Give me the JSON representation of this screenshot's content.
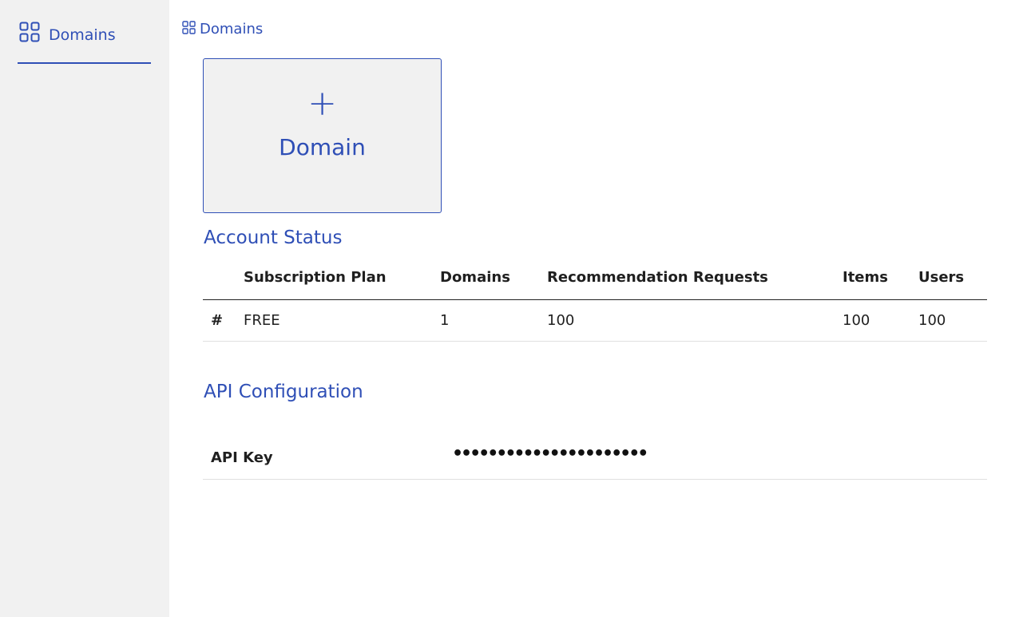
{
  "sidebar": {
    "items": [
      {
        "label": "Domains",
        "icon": "grid-icon"
      }
    ]
  },
  "breadcrumb": {
    "label": "Domains",
    "icon": "grid-icon"
  },
  "add_domain": {
    "plus": "+",
    "label": "Domain"
  },
  "account_status": {
    "title": "Account Status",
    "columns": [
      "",
      "Subscription Plan",
      "Domains",
      "Recommendation Requests",
      "Items",
      "Users"
    ],
    "rows": [
      [
        "#",
        "FREE",
        "1",
        "100",
        "100",
        "100"
      ]
    ]
  },
  "api_config": {
    "title": "API Configuration",
    "key_label": "API Key",
    "key_value": "••••••••••••••••••••••"
  },
  "colors": {
    "accent": "#2f4fb6",
    "sidebar_bg": "#f1f1f1"
  }
}
